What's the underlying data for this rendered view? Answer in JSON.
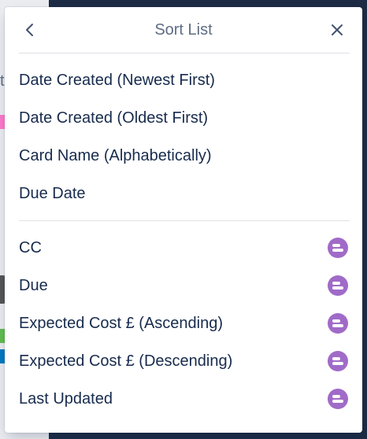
{
  "popover": {
    "title": "Sort List",
    "back_icon": "chevron-left-icon",
    "close_icon": "close-icon"
  },
  "sort_options": [
    {
      "label": "Date Created (Newest First)"
    },
    {
      "label": "Date Created (Oldest First)"
    },
    {
      "label": "Card Name (Alphabetically)"
    },
    {
      "label": "Due Date"
    }
  ],
  "field_options": [
    {
      "label": "CC",
      "icon": "custom-fields-powerup-icon"
    },
    {
      "label": "Due",
      "icon": "custom-fields-powerup-icon"
    },
    {
      "label": "Expected Cost £ (Ascending)",
      "icon": "custom-fields-powerup-icon"
    },
    {
      "label": "Expected Cost £ (Descending)",
      "icon": "custom-fields-powerup-icon"
    },
    {
      "label": "Last Updated",
      "icon": "custom-fields-powerup-icon"
    }
  ],
  "background": {
    "fragment_text": "t"
  },
  "colors": {
    "title": "#5e6c84",
    "text": "#172b4d",
    "powerup_icon": "#a06bc8",
    "divider": "#dfe1e6",
    "board_dark": "#1d2b45"
  }
}
